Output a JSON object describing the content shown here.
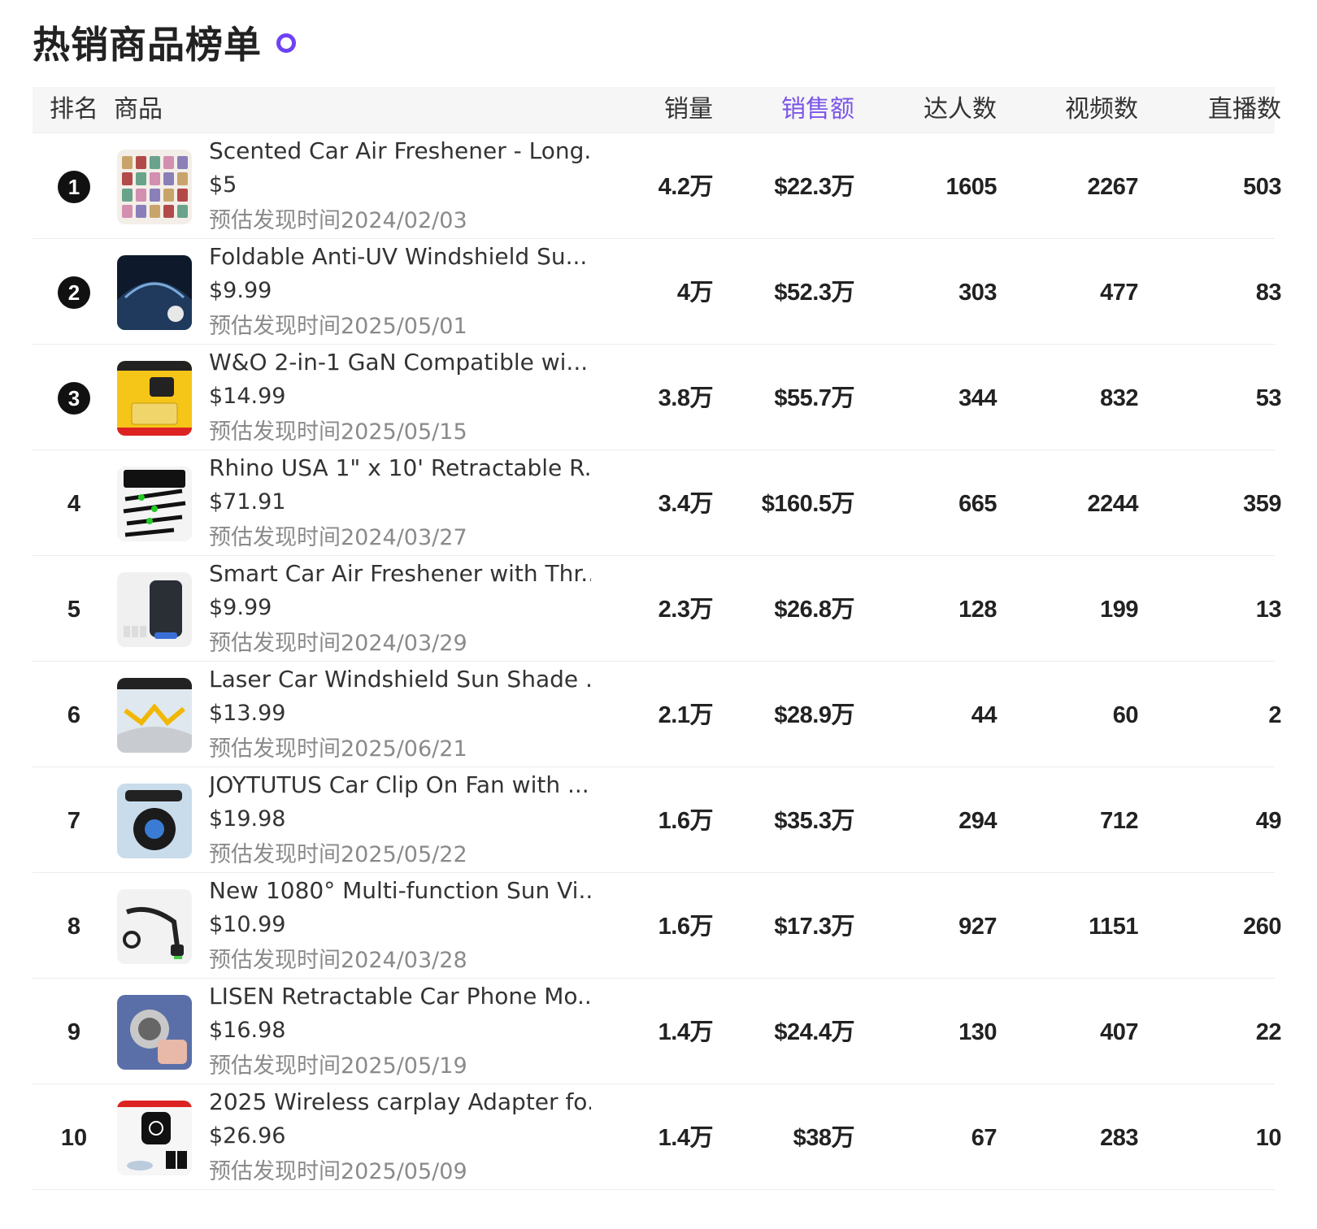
{
  "page": {
    "title": "热销商品榜单"
  },
  "table": {
    "headers": {
      "rank": "排名",
      "product": "商品",
      "sales": "销量",
      "amount": "销售额",
      "kol": "达人数",
      "video": "视频数",
      "live": "直播数"
    },
    "active_header": "amount",
    "accent_color": "#7b56e8",
    "rows": [
      {
        "rank": "1",
        "name": "Scented Car Air Freshener - Long...",
        "price": "$5",
        "date": "预估发现时间2024/02/03",
        "sales": "4.2万",
        "amount": "$22.3万",
        "kol": "1605",
        "video": "2267",
        "live": "503"
      },
      {
        "rank": "2",
        "name": "Foldable Anti-UV Windshield Su...",
        "price": "$9.99",
        "date": "预估发现时间2025/05/01",
        "sales": "4万",
        "amount": "$52.3万",
        "kol": "303",
        "video": "477",
        "live": "83"
      },
      {
        "rank": "3",
        "name": "W&O 2-in-1 GaN Compatible wi...",
        "price": "$14.99",
        "date": "预估发现时间2025/05/15",
        "sales": "3.8万",
        "amount": "$55.7万",
        "kol": "344",
        "video": "832",
        "live": "53"
      },
      {
        "rank": "4",
        "name": "Rhino USA 1\" x 10' Retractable R...",
        "price": "$71.91",
        "date": "预估发现时间2024/03/27",
        "sales": "3.4万",
        "amount": "$160.5万",
        "kol": "665",
        "video": "2244",
        "live": "359"
      },
      {
        "rank": "5",
        "name": "Smart Car Air Freshener with Thr...",
        "price": "$9.99",
        "date": "预估发现时间2024/03/29",
        "sales": "2.3万",
        "amount": "$26.8万",
        "kol": "128",
        "video": "199",
        "live": "13"
      },
      {
        "rank": "6",
        "name": "Laser Car Windshield Sun Shade ...",
        "price": "$13.99",
        "date": "预估发现时间2025/06/21",
        "sales": "2.1万",
        "amount": "$28.9万",
        "kol": "44",
        "video": "60",
        "live": "2"
      },
      {
        "rank": "7",
        "name": "JOYTUTUS Car Clip On Fan with ...",
        "price": "$19.98",
        "date": "预估发现时间2025/05/22",
        "sales": "1.6万",
        "amount": "$35.3万",
        "kol": "294",
        "video": "712",
        "live": "49"
      },
      {
        "rank": "8",
        "name": "New 1080° Multi-function Sun Vi...",
        "price": "$10.99",
        "date": "预估发现时间2024/03/28",
        "sales": "1.6万",
        "amount": "$17.3万",
        "kol": "927",
        "video": "1151",
        "live": "260"
      },
      {
        "rank": "9",
        "name": "LISEN Retractable Car Phone Mo...",
        "price": "$16.98",
        "date": "预估发现时间2025/05/19",
        "sales": "1.4万",
        "amount": "$24.4万",
        "kol": "130",
        "video": "407",
        "live": "22"
      },
      {
        "rank": "10",
        "name": "2025 Wireless carplay Adapter fo...",
        "price": "$26.96",
        "date": "预估发现时间2025/05/09",
        "sales": "1.4万",
        "amount": "$38万",
        "kol": "67",
        "video": "283",
        "live": "10"
      }
    ]
  }
}
